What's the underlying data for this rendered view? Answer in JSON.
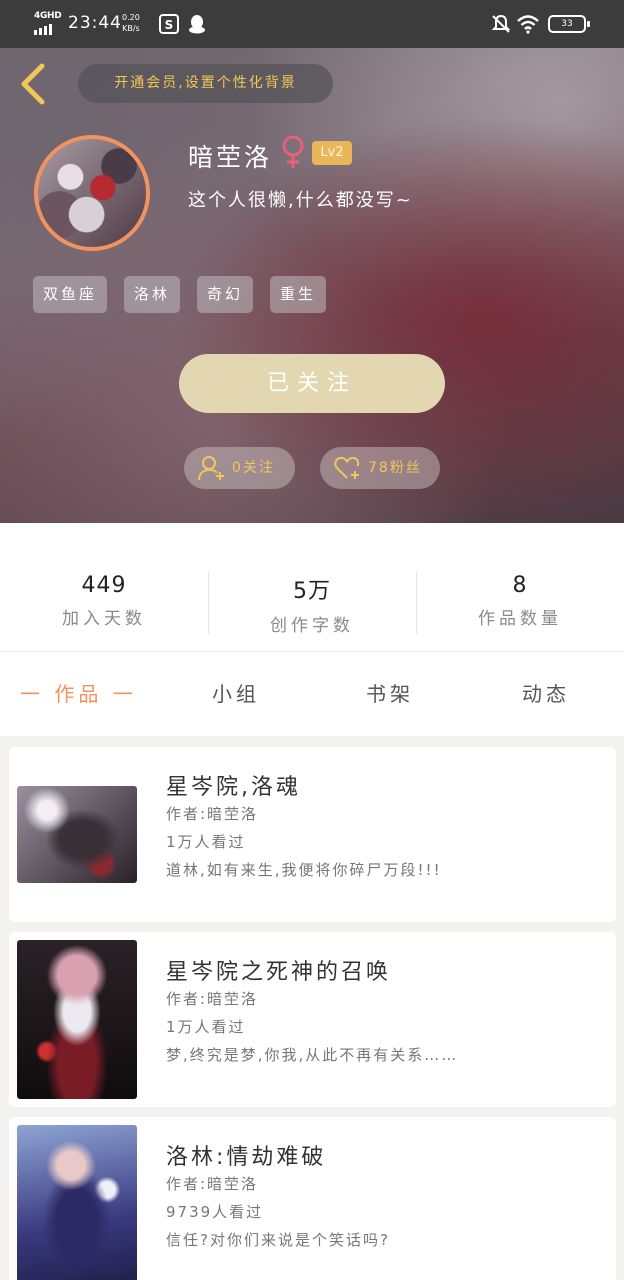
{
  "status_bar": {
    "network": "4GHD",
    "time": "23:44",
    "speed_value": "0.20",
    "speed_unit": "KB/s",
    "battery": "33"
  },
  "header": {
    "vip_banner": "开通会员,设置个性化背景",
    "username": "暗茔洛",
    "level": "Lv2",
    "bio": "这个人很懒,什么都没写~",
    "tags": [
      "双鱼座",
      "洛林",
      "奇幻",
      "重生"
    ],
    "follow_button": "已关注",
    "following": "0关注",
    "fans": "78粉丝",
    "accent_color": "#f1c75a"
  },
  "stats": [
    {
      "value": "449",
      "label": "加入天数"
    },
    {
      "value": "5万",
      "label": "创作字数"
    },
    {
      "value": "8",
      "label": "作品数量"
    }
  ],
  "tabs": [
    {
      "label": "一 作品 一",
      "active": true
    },
    {
      "label": "小组",
      "active": false
    },
    {
      "label": "书架",
      "active": false
    },
    {
      "label": "动态",
      "active": false
    }
  ],
  "works": [
    {
      "title": "星岑院,洛魂",
      "author": "作者:暗茔洛",
      "views": "1万人看过",
      "summary": "道林,如有来生,我便将你碎尸万段!!!"
    },
    {
      "title": "星岑院之死神的召唤",
      "author": "作者:暗茔洛",
      "views": "1万人看过",
      "summary": "梦,终究是梦,你我,从此不再有关系……"
    },
    {
      "title": "洛林:情劫难破",
      "author": "作者:暗茔洛",
      "views": "9739人看过",
      "summary": "信任?对你们来说是个笑话吗?"
    }
  ]
}
